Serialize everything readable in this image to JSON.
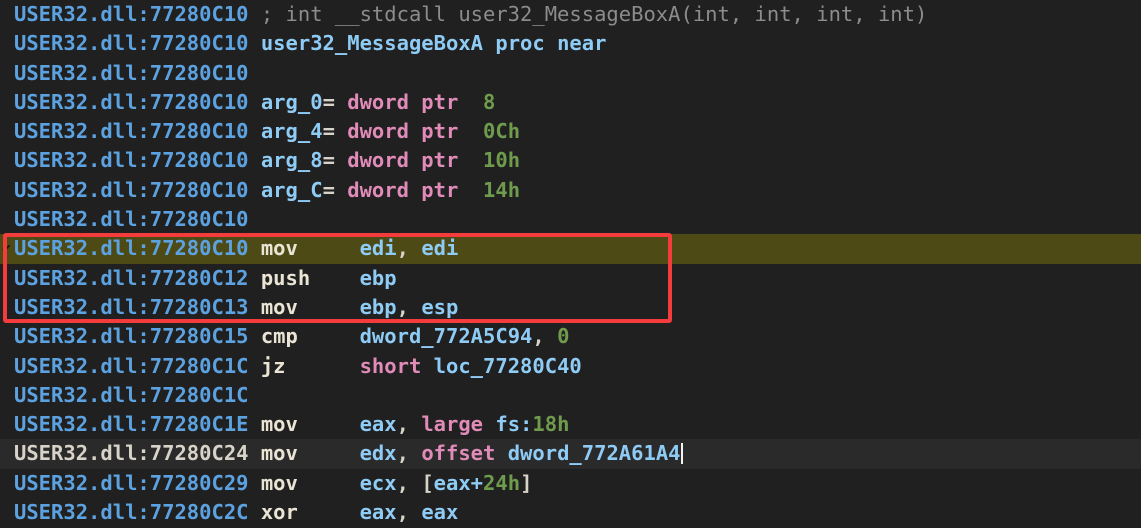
{
  "window": {
    "title": "IDA View-A  (USER32.dll disassembly)",
    "background": "#202020",
    "selected_line_background": "#4d4a16",
    "cursor_line_background": "#2a2a2a",
    "annotation_box_color": "#f43c3c"
  },
  "palette": {
    "address": "#5da2e0",
    "address_current": "#d8d3c8",
    "comment": "#8c8c8c",
    "name": "#8ecbf5",
    "mnemonic": "#eae4d4",
    "register": "#8ecbf5",
    "datatype_keyword": "#e08bb8",
    "number": "#6f9b4d",
    "punctuation": "#d8d3c8"
  },
  "module": "USER32.dll",
  "gutter_marker": "✔",
  "caret_after_text": "dword_772A61A4",
  "lines": [
    {
      "address": "USER32.dll:77280C10",
      "state": "normal",
      "tokens": [
        {
          "text": "; int __stdcall user32_MessageBoxA(int, int, int, int)",
          "cls": "t-cmt"
        }
      ]
    },
    {
      "address": "USER32.dll:77280C10",
      "state": "normal",
      "tokens": [
        {
          "text": "user32_MessageBoxA",
          "cls": "t-name"
        },
        {
          "text": " ",
          "cls": "t-punct"
        },
        {
          "text": "proc near",
          "cls": "t-kw"
        }
      ]
    },
    {
      "address": "USER32.dll:77280C10",
      "state": "normal",
      "tokens": []
    },
    {
      "address": "USER32.dll:77280C10",
      "state": "normal",
      "tokens": [
        {
          "text": "arg_0",
          "cls": "t-name"
        },
        {
          "text": "= ",
          "cls": "t-eq"
        },
        {
          "text": "dword ptr",
          "cls": "t-type"
        },
        {
          "text": "  ",
          "cls": "t-punct"
        },
        {
          "text": "8",
          "cls": "t-num"
        }
      ]
    },
    {
      "address": "USER32.dll:77280C10",
      "state": "normal",
      "tokens": [
        {
          "text": "arg_4",
          "cls": "t-name"
        },
        {
          "text": "= ",
          "cls": "t-eq"
        },
        {
          "text": "dword ptr",
          "cls": "t-type"
        },
        {
          "text": "  ",
          "cls": "t-punct"
        },
        {
          "text": "0Ch",
          "cls": "t-num"
        }
      ]
    },
    {
      "address": "USER32.dll:77280C10",
      "state": "normal",
      "tokens": [
        {
          "text": "arg_8",
          "cls": "t-name"
        },
        {
          "text": "= ",
          "cls": "t-eq"
        },
        {
          "text": "dword ptr",
          "cls": "t-type"
        },
        {
          "text": "  ",
          "cls": "t-punct"
        },
        {
          "text": "10h",
          "cls": "t-num"
        }
      ]
    },
    {
      "address": "USER32.dll:77280C10",
      "state": "normal",
      "tokens": [
        {
          "text": "arg_C",
          "cls": "t-name"
        },
        {
          "text": "= ",
          "cls": "t-eq"
        },
        {
          "text": "dword ptr",
          "cls": "t-type"
        },
        {
          "text": "  ",
          "cls": "t-punct"
        },
        {
          "text": "14h",
          "cls": "t-num"
        }
      ]
    },
    {
      "address": "USER32.dll:77280C10",
      "state": "normal",
      "tokens": []
    },
    {
      "address": "USER32.dll:77280C10",
      "state": "selected",
      "tokens": [
        {
          "text": "mov",
          "cls": "t-mnem"
        },
        {
          "text": "     ",
          "cls": "t-punct"
        },
        {
          "text": "edi",
          "cls": "t-reg"
        },
        {
          "text": ", ",
          "cls": "t-punct"
        },
        {
          "text": "edi",
          "cls": "t-reg"
        }
      ]
    },
    {
      "address": "USER32.dll:77280C12",
      "state": "normal",
      "tokens": [
        {
          "text": "push",
          "cls": "t-mnem"
        },
        {
          "text": "    ",
          "cls": "t-punct"
        },
        {
          "text": "ebp",
          "cls": "t-reg"
        }
      ]
    },
    {
      "address": "USER32.dll:77280C13",
      "state": "normal",
      "tokens": [
        {
          "text": "mov",
          "cls": "t-mnem"
        },
        {
          "text": "     ",
          "cls": "t-punct"
        },
        {
          "text": "ebp",
          "cls": "t-reg"
        },
        {
          "text": ", ",
          "cls": "t-punct"
        },
        {
          "text": "esp",
          "cls": "t-reg"
        }
      ]
    },
    {
      "address": "USER32.dll:77280C15",
      "state": "normal",
      "tokens": [
        {
          "text": "cmp",
          "cls": "t-mnem"
        },
        {
          "text": "     ",
          "cls": "t-punct"
        },
        {
          "text": "dword_772A5C94",
          "cls": "t-sym"
        },
        {
          "text": ", ",
          "cls": "t-punct"
        },
        {
          "text": "0",
          "cls": "t-num"
        }
      ]
    },
    {
      "address": "USER32.dll:77280C1C",
      "state": "normal",
      "tokens": [
        {
          "text": "jz",
          "cls": "t-mnem"
        },
        {
          "text": "      ",
          "cls": "t-punct"
        },
        {
          "text": "short",
          "cls": "t-type"
        },
        {
          "text": " ",
          "cls": "t-punct"
        },
        {
          "text": "loc_77280C40",
          "cls": "t-sym"
        }
      ]
    },
    {
      "address": "USER32.dll:77280C1C",
      "state": "normal",
      "tokens": []
    },
    {
      "address": "USER32.dll:77280C1E",
      "state": "normal",
      "tokens": [
        {
          "text": "mov",
          "cls": "t-mnem"
        },
        {
          "text": "     ",
          "cls": "t-punct"
        },
        {
          "text": "eax",
          "cls": "t-reg"
        },
        {
          "text": ", ",
          "cls": "t-punct"
        },
        {
          "text": "large",
          "cls": "t-type"
        },
        {
          "text": " ",
          "cls": "t-punct"
        },
        {
          "text": "fs:",
          "cls": "t-reg"
        },
        {
          "text": "18h",
          "cls": "t-num"
        }
      ]
    },
    {
      "address": "USER32.dll:77280C24",
      "state": "cursor",
      "tokens": [
        {
          "text": "mov",
          "cls": "t-mnem"
        },
        {
          "text": "     ",
          "cls": "t-punct"
        },
        {
          "text": "edx",
          "cls": "t-reg"
        },
        {
          "text": ", ",
          "cls": "t-punct"
        },
        {
          "text": "offset",
          "cls": "t-type"
        },
        {
          "text": " ",
          "cls": "t-punct"
        },
        {
          "text": "dword_772A61A4",
          "cls": "t-sym"
        }
      ]
    },
    {
      "address": "USER32.dll:77280C29",
      "state": "normal",
      "tokens": [
        {
          "text": "mov",
          "cls": "t-mnem"
        },
        {
          "text": "     ",
          "cls": "t-punct"
        },
        {
          "text": "ecx",
          "cls": "t-reg"
        },
        {
          "text": ", ",
          "cls": "t-punct"
        },
        {
          "text": "[",
          "cls": "t-punct"
        },
        {
          "text": "eax+",
          "cls": "t-reg"
        },
        {
          "text": "24h",
          "cls": "t-num"
        },
        {
          "text": "]",
          "cls": "t-punct"
        }
      ]
    },
    {
      "address": "USER32.dll:77280C2C",
      "state": "normal",
      "tokens": [
        {
          "text": "xor",
          "cls": "t-mnem"
        },
        {
          "text": "     ",
          "cls": "t-punct"
        },
        {
          "text": "eax",
          "cls": "t-reg"
        },
        {
          "text": ", ",
          "cls": "t-punct"
        },
        {
          "text": "eax",
          "cls": "t-reg"
        }
      ]
    }
  ]
}
